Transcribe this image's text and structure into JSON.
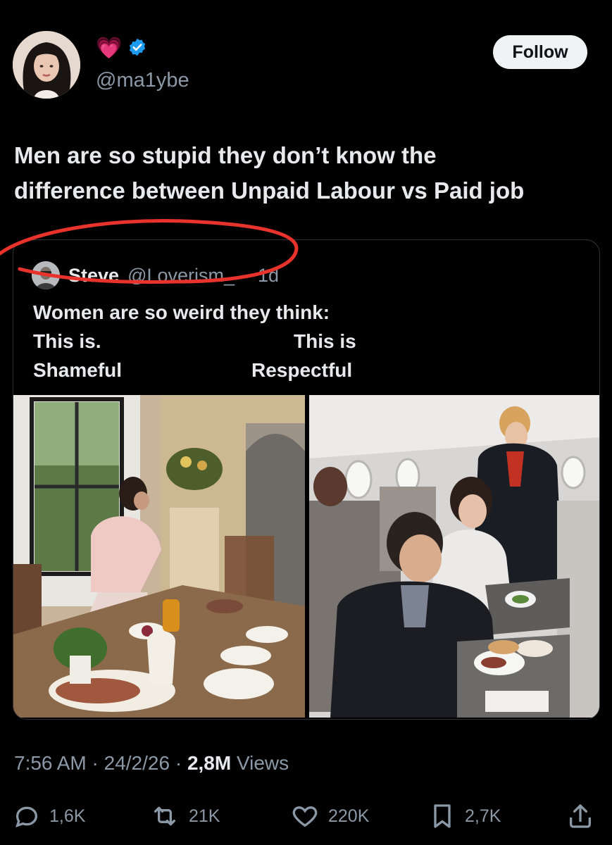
{
  "author": {
    "handle": "@ma1ybe",
    "emoji_badge": "💗",
    "verified": true,
    "follow_label": "Follow"
  },
  "tweet": {
    "lines": [
      "Men are so stupid they don’t know the",
      "difference between Unpaid Labour vs Paid job"
    ]
  },
  "quote": {
    "name": "Steve",
    "handle": "@Loverism_",
    "separator": "·",
    "age": "1d",
    "line1": "Women are so weird they think:",
    "left_col": [
      "This is.",
      "Shameful"
    ],
    "right_col": [
      "This is",
      "Respectful"
    ]
  },
  "meta": {
    "time": "7:56 AM",
    "date": "24/2/26",
    "views_count": "2,8M",
    "views_label": "Views",
    "dot": "·"
  },
  "actions": {
    "replies": "1,6K",
    "reposts": "21K",
    "likes": "220K",
    "bookmarks": "2,7K"
  },
  "colors": {
    "background": "#000000",
    "text": "#e7e9ea",
    "muted": "#8b98a5",
    "verified": "#1d9bf0",
    "annotation": "#e8322c"
  }
}
